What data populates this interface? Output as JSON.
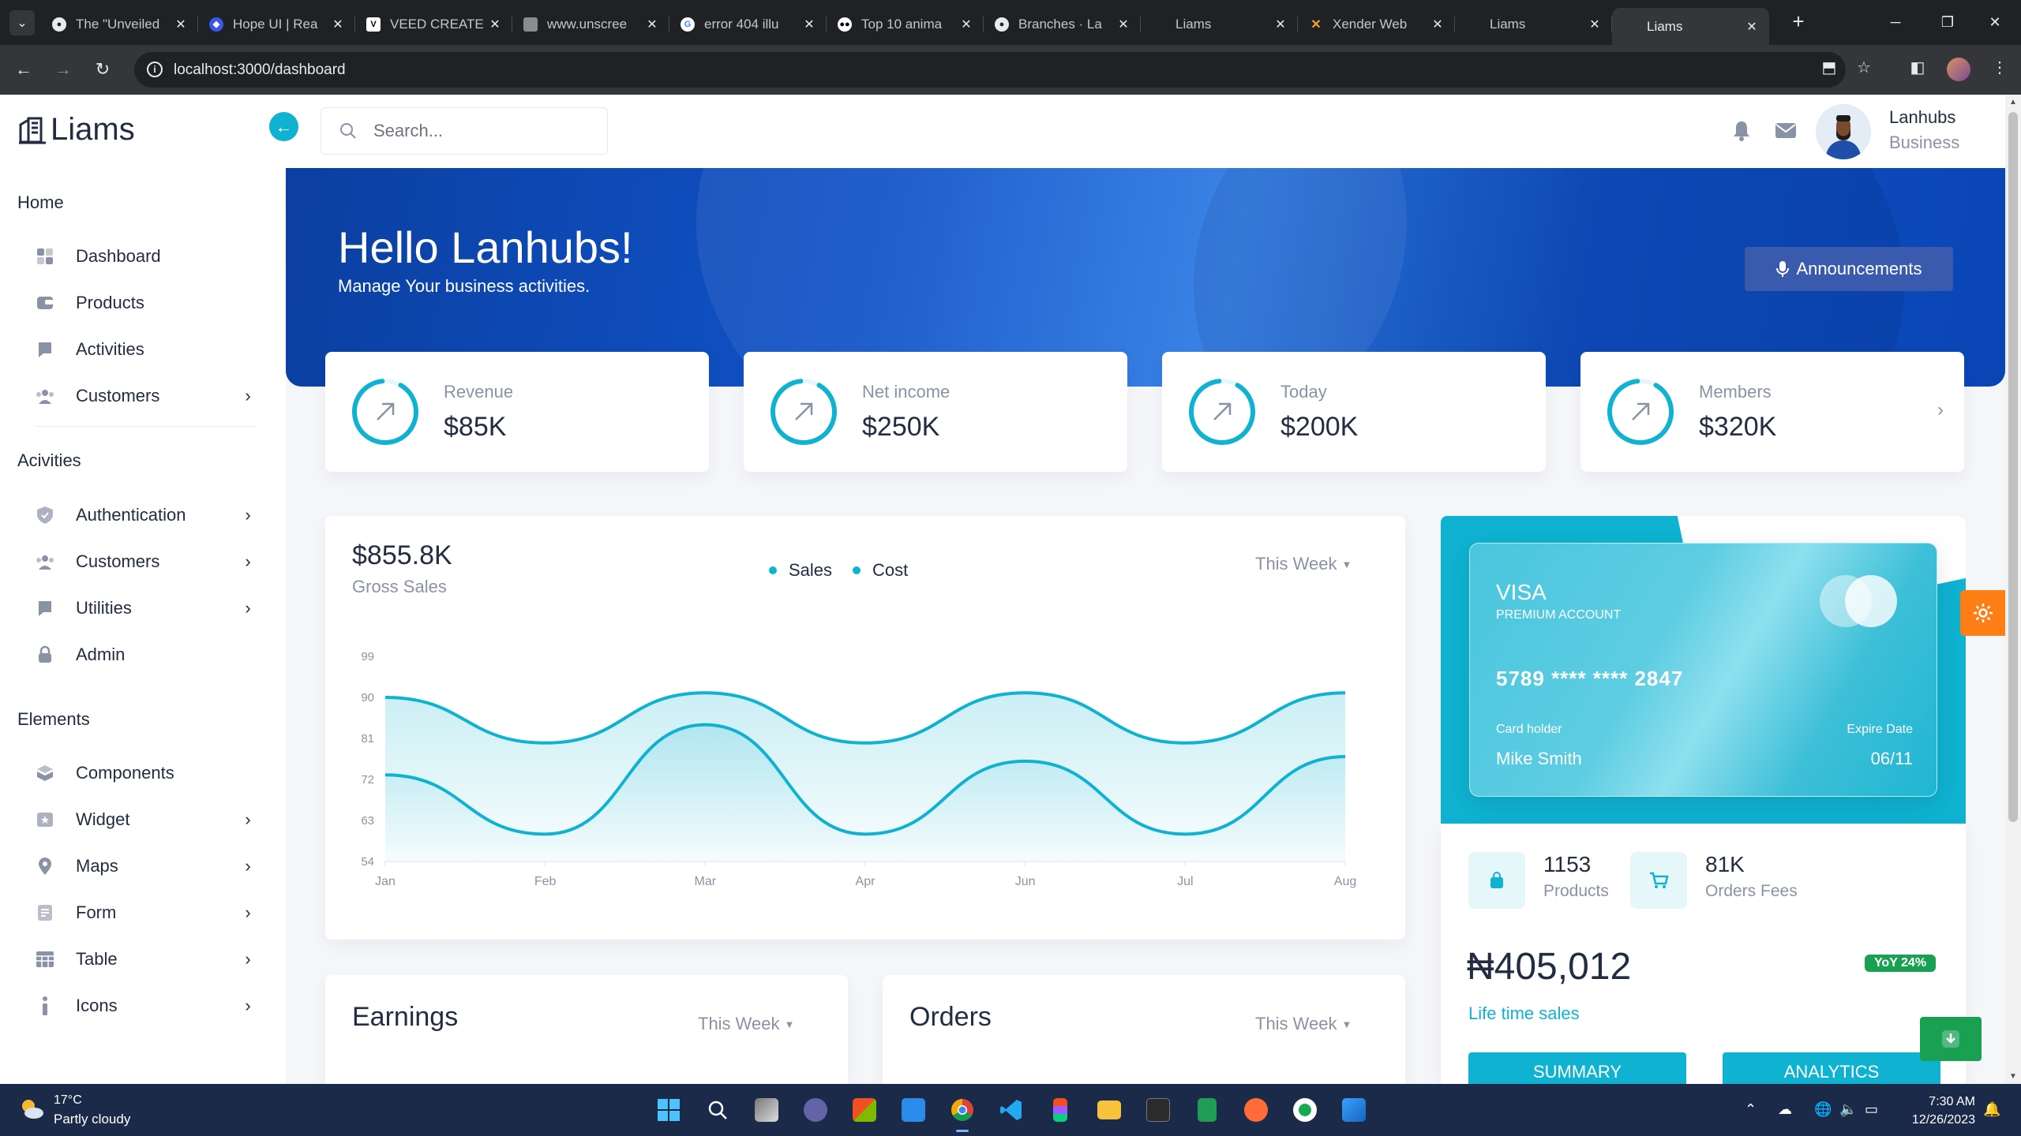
{
  "browser": {
    "tabs": [
      {
        "title": "The \"Unveiled",
        "favicon": "github-icon"
      },
      {
        "title": "Hope UI | Rea",
        "favicon": "hope-ui-icon"
      },
      {
        "title": "VEED CREATE",
        "favicon": "veed-icon"
      },
      {
        "title": "www.unscree",
        "favicon": "image-icon"
      },
      {
        "title": "error 404 illu",
        "favicon": "google-icon"
      },
      {
        "title": "Top 10 anima",
        "favicon": "medium-icon"
      },
      {
        "title": "Branches · La",
        "favicon": "github-icon"
      },
      {
        "title": "Liams",
        "favicon": "blank-icon"
      },
      {
        "title": "Xender Web",
        "favicon": "xender-icon"
      },
      {
        "title": "Liams",
        "favicon": "blank-icon"
      },
      {
        "title": "Liams",
        "favicon": "blank-icon",
        "active": true
      }
    ],
    "url": "localhost:3000/dashboard"
  },
  "sidebar": {
    "logo": "Liams",
    "sections": [
      {
        "title": "Home",
        "items": [
          {
            "label": "Dashboard",
            "icon": "dashboard-icon",
            "chevron": false
          },
          {
            "label": "Products",
            "icon": "products-icon",
            "chevron": false
          },
          {
            "label": "Activities",
            "icon": "activities-icon",
            "chevron": false
          },
          {
            "label": "Customers",
            "icon": "customers-icon",
            "chevron": true
          }
        ]
      },
      {
        "title": "Acivities",
        "items": [
          {
            "label": "Authentication",
            "icon": "shield-icon",
            "chevron": true
          },
          {
            "label": "Customers",
            "icon": "customers-icon",
            "chevron": true
          },
          {
            "label": "Utilities",
            "icon": "utilities-icon",
            "chevron": true
          },
          {
            "label": "Admin",
            "icon": "lock-icon",
            "chevron": false
          }
        ]
      },
      {
        "title": "Elements",
        "items": [
          {
            "label": "Components",
            "icon": "components-icon",
            "chevron": false
          },
          {
            "label": "Widget",
            "icon": "widget-icon",
            "chevron": true
          },
          {
            "label": "Maps",
            "icon": "map-pin-icon",
            "chevron": true
          },
          {
            "label": "Form",
            "icon": "form-icon",
            "chevron": true
          },
          {
            "label": "Table",
            "icon": "table-icon",
            "chevron": true
          },
          {
            "label": "Icons",
            "icon": "info-icon",
            "chevron": true
          }
        ]
      }
    ]
  },
  "topnav": {
    "search_placeholder": "Search...",
    "user_name": "Lanhubs",
    "user_role": "Business"
  },
  "hero": {
    "title": "Hello Lanhubs!",
    "subtitle": "Manage Your business activities.",
    "announcements_label": "Announcements"
  },
  "stats": [
    {
      "label": "Revenue",
      "value": "$85K",
      "progress": 0.9
    },
    {
      "label": "Net income",
      "value": "$250K",
      "progress": 0.9
    },
    {
      "label": "Today",
      "value": "$200K",
      "progress": 0.9
    },
    {
      "label": "Members",
      "value": "$320K",
      "progress": 0.9
    }
  ],
  "gross_sales": {
    "value": "$855.8K",
    "label": "Gross Sales",
    "filter": "This Week",
    "legend": [
      "Sales",
      "Cost"
    ]
  },
  "chart_data": {
    "type": "area",
    "categories": [
      "Jan",
      "Feb",
      "Mar",
      "Apr",
      "Jun",
      "Jul",
      "Aug"
    ],
    "series": [
      {
        "name": "Sales",
        "values": [
          90,
          80,
          91,
          80,
          91,
          80,
          91
        ]
      },
      {
        "name": "Cost",
        "values": [
          73,
          60,
          84,
          60,
          76,
          60,
          77
        ]
      }
    ],
    "yticks": [
      99,
      90,
      81,
      72,
      63,
      54
    ],
    "ylim": [
      54,
      99
    ],
    "grid": false,
    "colors": {
      "line": "#0fb2d1"
    }
  },
  "visa_card": {
    "brand": "VISA",
    "account": "PREMIUM ACCOUNT",
    "number": "5789 **** **** 2847",
    "holder_label": "Card holder",
    "holder": "Mike Smith",
    "expiry_label": "Expire Date",
    "expiry": "06/11"
  },
  "mini_stats": [
    {
      "value": "1153",
      "label": "Products",
      "icon": "bag-icon"
    },
    {
      "value": "81K",
      "label": "Orders Fees",
      "icon": "cart-icon"
    }
  ],
  "lifetime": {
    "amount": "₦405,012",
    "label": "Life time sales",
    "badge": "YoY 24%"
  },
  "buttons": {
    "summary": "SUMMARY",
    "analytics": "ANALYTICS"
  },
  "earnings": {
    "title": "Earnings",
    "filter": "This Week"
  },
  "orders": {
    "title": "Orders",
    "filter": "This Week"
  },
  "taskbar": {
    "temperature": "17°C",
    "condition": "Partly cloudy",
    "time": "7:30 AM",
    "date": "12/26/2023"
  },
  "colors": {
    "accent": "#0fb2d1",
    "primary": "#0b47b8",
    "success": "#1aa053",
    "warning": "#fd7e14"
  }
}
